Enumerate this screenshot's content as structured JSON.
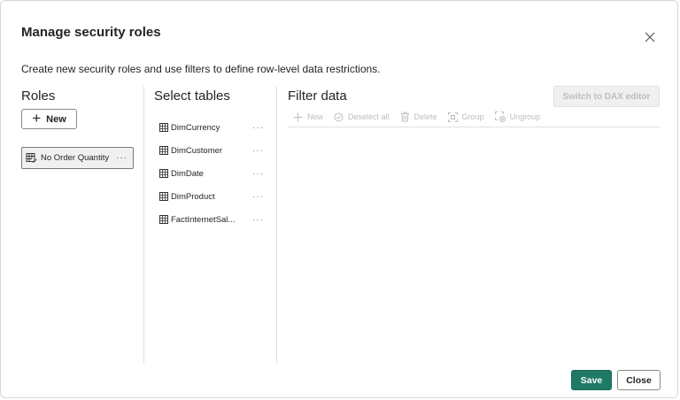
{
  "dialog": {
    "title": "Manage security roles",
    "description": "Create new security roles and use filters to define row-level data restrictions.",
    "close_icon": "close-icon"
  },
  "roles": {
    "heading": "Roles",
    "new_label": "New",
    "items": [
      {
        "label": "No Order Quantity",
        "more": "···"
      }
    ]
  },
  "tables": {
    "heading": "Select tables",
    "items": [
      {
        "label": "DimCurrency",
        "more": "···"
      },
      {
        "label": "DimCustomer",
        "more": "···"
      },
      {
        "label": "DimDate",
        "more": "···"
      },
      {
        "label": "DimProduct",
        "more": "···"
      },
      {
        "label": "FactInternetSal...",
        "more": "···"
      }
    ]
  },
  "filter": {
    "heading": "Filter data",
    "dax_button": "Switch to DAX editor",
    "toolbar": {
      "new": "New",
      "deselect_all": "Deselect all",
      "delete": "Delete",
      "group": "Group",
      "ungroup": "Ungroup"
    }
  },
  "footer": {
    "save": "Save",
    "close": "Close"
  },
  "colors": {
    "primary": "#1f7a65",
    "disabled_text": "#bdbdbd",
    "border": "#e1e1e1"
  }
}
